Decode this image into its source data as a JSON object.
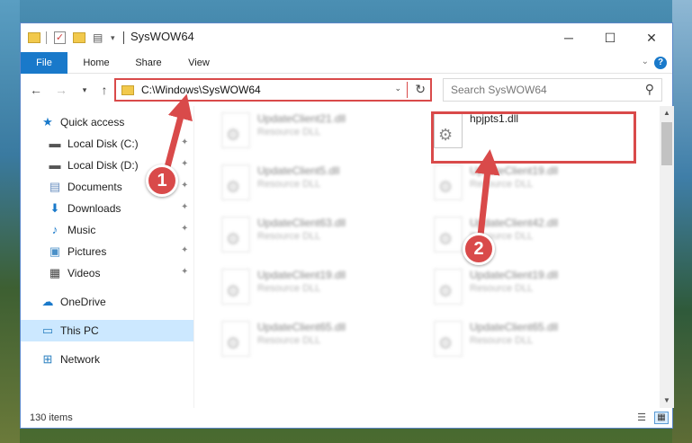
{
  "window": {
    "title": "SysWOW64",
    "controls": {
      "minimize": "─",
      "maximize": "☐",
      "close": "✕"
    }
  },
  "quick_access_toolbar": {
    "check_glyph": "✓",
    "properties_glyph": "▤",
    "dropdown_glyph": "▾"
  },
  "ribbon": {
    "tabs": [
      {
        "label": "File",
        "active": true
      },
      {
        "label": "Home"
      },
      {
        "label": "Share"
      },
      {
        "label": "View"
      }
    ],
    "expand_glyph": "⌄",
    "help_glyph": "?"
  },
  "navigation": {
    "back_glyph": "←",
    "forward_glyph": "→",
    "recent_glyph": "▾",
    "up_glyph": "↑",
    "address": "C:\\Windows\\SysWOW64",
    "address_dropdown_glyph": "⌄",
    "refresh_glyph": "↻",
    "search_placeholder": "Search SysWOW64",
    "search_glyph": "⚲"
  },
  "nav_pane": {
    "items": [
      {
        "label": "Quick access",
        "icon": "star-icon",
        "glyph": "★"
      },
      {
        "label": "Local Disk (C:)",
        "icon": "drive-icon",
        "glyph": "▬",
        "pinned": true
      },
      {
        "label": "Local Disk (D:)",
        "icon": "drive-icon",
        "glyph": "▬",
        "pinned": true
      },
      {
        "label": "Documents",
        "icon": "documents-icon",
        "glyph": "▤",
        "pinned": true
      },
      {
        "label": "Downloads",
        "icon": "download-icon",
        "glyph": "⬇",
        "pinned": true
      },
      {
        "label": "Music",
        "icon": "music-icon",
        "glyph": "♪",
        "pinned": true
      },
      {
        "label": "Pictures",
        "icon": "pictures-icon",
        "glyph": "▣",
        "pinned": true
      },
      {
        "label": "Videos",
        "icon": "videos-icon",
        "glyph": "▦",
        "pinned": true
      },
      {
        "label": "OneDrive",
        "icon": "cloud-icon",
        "glyph": "☁"
      },
      {
        "label": "This PC",
        "icon": "computer-icon",
        "glyph": "▭",
        "selected": true
      },
      {
        "label": "Network",
        "icon": "network-icon",
        "glyph": "⊞"
      }
    ],
    "pin_glyph": "📌"
  },
  "files": [
    {
      "name": "UpdateClient21.dll",
      "type": "Resource DLL"
    },
    {
      "name": "hpjpts1.dll",
      "type": ""
    },
    {
      "name": "UpdateClient5.dll",
      "type": "Resource DLL"
    },
    {
      "name": "UpdateClient19.dll",
      "type": "Resource DLL"
    },
    {
      "name": "UpdateClient63.dll",
      "type": "Resource DLL"
    },
    {
      "name": "UpdateClient42.dll",
      "type": "Resource DLL"
    },
    {
      "name": "UpdateClient19.dll",
      "type": "Resource DLL"
    },
    {
      "name": "UpdateClient19.dll",
      "type": "Resource DLL"
    },
    {
      "name": "UpdateClient65.dll",
      "type": "Resource DLL"
    },
    {
      "name": "UpdateClient65.dll",
      "type": "Resource DLL"
    }
  ],
  "scrollbar": {
    "up_glyph": "▲",
    "down_glyph": "▼"
  },
  "status": {
    "item_count": "130 items",
    "details_glyph": "☰",
    "large_icons_glyph": "▦"
  },
  "annotations": {
    "step1": "1",
    "step2": "2",
    "color": "#d94a4a"
  }
}
